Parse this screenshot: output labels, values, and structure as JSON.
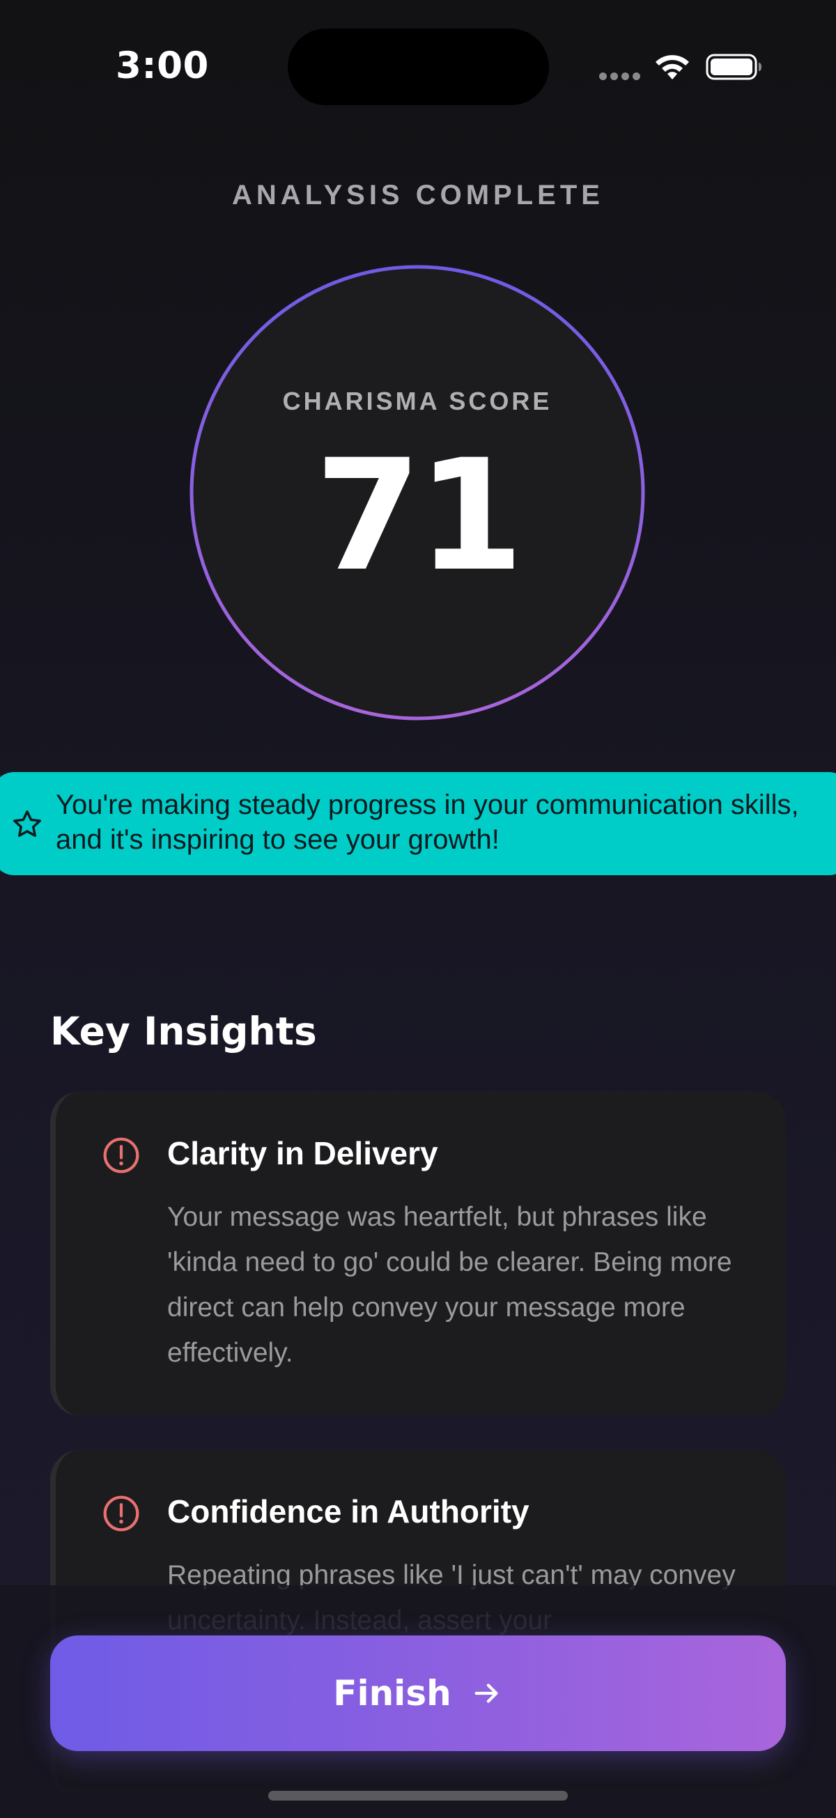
{
  "status_bar": {
    "time": "3:00"
  },
  "header": {
    "title": "ANALYSIS COMPLETE"
  },
  "score": {
    "label": "CHARISMA SCORE",
    "value": "71",
    "ring_colors": [
      "#6f5ce6",
      "#a965dc"
    ]
  },
  "banner": {
    "icon": "star-icon",
    "text": "You're making steady progress in your communication skills, and it's inspiring to see your growth!",
    "color": "#00cdc8"
  },
  "insights": {
    "title": "Key Insights",
    "items": [
      {
        "icon": "alert-circle-icon",
        "title": "Clarity in Delivery",
        "body": "Your message was heartfelt, but phrases like 'kinda need to go' could be clearer. Being more direct can help convey your message more effectively."
      },
      {
        "icon": "alert-circle-icon",
        "title": "Confidence in Authority",
        "body": "Repeating phrases like 'I just can't' may convey uncertainty. Instead, assert your"
      }
    ],
    "alert_color": "#e8716f"
  },
  "footer": {
    "finish_label": "Finish",
    "finish_icon": "arrow-right-icon"
  }
}
